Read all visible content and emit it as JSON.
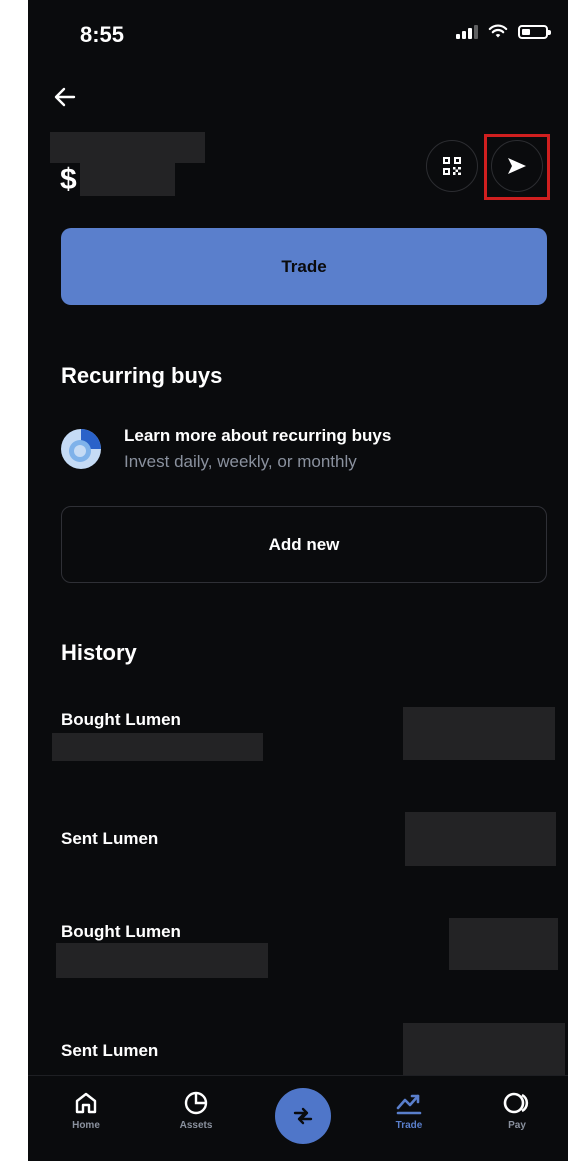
{
  "status_bar": {
    "time": "8:55"
  },
  "header": {
    "balance_prefix": "$"
  },
  "actions": {
    "trade_label": "Trade"
  },
  "recurring": {
    "title": "Recurring buys",
    "learn_title": "Learn more about recurring buys",
    "learn_subtitle": "Invest daily, weekly, or monthly",
    "add_label": "Add new"
  },
  "history": {
    "title": "History",
    "items": [
      {
        "label": "Bought Lumen"
      },
      {
        "label": "Sent Lumen"
      },
      {
        "label": "Bought Lumen"
      },
      {
        "label": "Sent Lumen"
      }
    ]
  },
  "tabbar": {
    "items": [
      {
        "label": "Home",
        "icon": "home-icon"
      },
      {
        "label": "Assets",
        "icon": "pie-chart-icon"
      },
      {
        "label": "",
        "icon": "swap-icon"
      },
      {
        "label": "Trade",
        "icon": "trending-up-icon"
      },
      {
        "label": "Pay",
        "icon": "pay-icon"
      }
    ],
    "active": "Trade"
  },
  "colors": {
    "background": "#0a0b0d",
    "accent": "#5a7fcc",
    "muted_text": "#8a919e",
    "highlight_box": "#d01f1f"
  }
}
